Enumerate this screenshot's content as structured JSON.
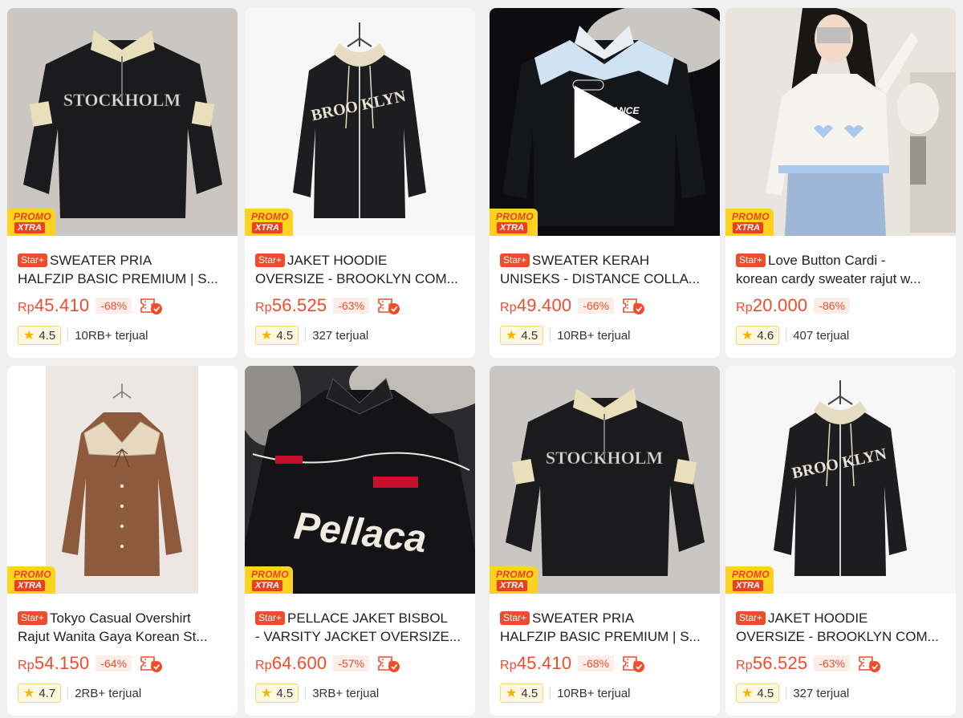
{
  "promo": {
    "line1": "PROMO",
    "line2": "XTRA"
  },
  "star_badge": "Star+",
  "currency": "Rp",
  "products": [
    {
      "title1": "SWEATER PRIA",
      "title2": "HALFZIP BASIC PREMIUM | S...",
      "price": "45.410",
      "discount": "-68%",
      "rating": "4.5",
      "sold": "10RB+ terjual",
      "image": "black halfzip sweater with cream collar and STOCKHOLM print"
    },
    {
      "title1": "JAKET HOODIE",
      "title2": "OVERSIZE - BROOKLYN COM...",
      "price": "56.525",
      "discount": "-63%",
      "rating": "4.5",
      "sold": "327 terjual",
      "image": "black zip hoodie with BROOKLYN print on hanger"
    },
    {
      "title1": "SWEATER KERAH",
      "title2": "UNISEKS - DISTANCE COLLA...",
      "price": "49.400",
      "discount": "-66%",
      "rating": "4.5",
      "sold": "10RB+ terjual",
      "image": "black collared racing sweater with DISTANCE print"
    },
    {
      "title1": "Love Button Cardi -",
      "title2": "korean cardy sweater rajut w...",
      "price": "20.000",
      "discount": "-86%",
      "rating": "4.6",
      "sold": "407 terjual",
      "image": "woman wearing cream knit cardigan with heart motif"
    },
    {
      "title1": "Tokyo Casual Overshirt",
      "title2": "Rajut Wanita Gaya Korean St...",
      "price": "54.150",
      "discount": "-64%",
      "rating": "4.7",
      "sold": "2RB+ terjual",
      "image": "brown knit cardigan with lace collar"
    },
    {
      "title1": "PELLACE JAKET BISBOL",
      "title2": "- VARSITY JACKET OVERSIZE...",
      "price": "64.600",
      "discount": "-57%",
      "rating": "4.5",
      "sold": "3RB+ terjual",
      "image": "black varsity jacket with Pellaca patches"
    },
    {
      "title1": "SWEATER PRIA",
      "title2": "HALFZIP BASIC PREMIUM | S...",
      "price": "45.410",
      "discount": "-68%",
      "rating": "4.5",
      "sold": "10RB+ terjual",
      "image": "black halfzip sweater with cream collar and STOCKHOLM print"
    },
    {
      "title1": "JAKET HOODIE",
      "title2": "OVERSIZE - BROOKLYN COM...",
      "price": "56.525",
      "discount": "-63%",
      "rating": "4.5",
      "sold": "327 terjual",
      "image": "black zip hoodie with BROOKLYN print on hanger"
    }
  ],
  "colors": {
    "accent": "#ee4d2d",
    "promo_yellow": "#ffd21f",
    "star": "#f5b400",
    "background": "#f0f0f0"
  }
}
